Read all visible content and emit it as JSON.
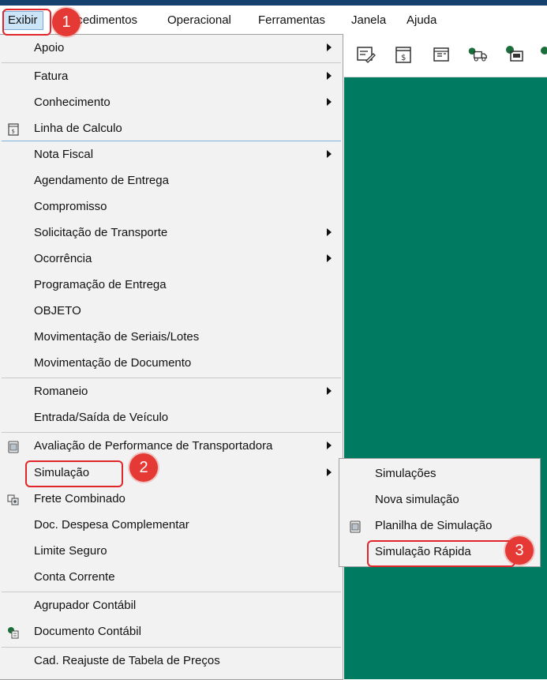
{
  "menubar": {
    "items": [
      {
        "label": "Exibir"
      },
      {
        "label": "Procedimentos"
      },
      {
        "label": "Operacional"
      },
      {
        "label": "Ferramentas"
      },
      {
        "label": "Janela"
      },
      {
        "label": "Ajuda"
      }
    ]
  },
  "exibir_menu": {
    "items": [
      {
        "label": "Apoio"
      },
      {
        "label": "Fatura"
      },
      {
        "label": "Conhecimento"
      },
      {
        "label": "Linha de Calculo"
      },
      {
        "label": "Nota Fiscal"
      },
      {
        "label": "Agendamento de Entrega"
      },
      {
        "label": "Compromisso"
      },
      {
        "label": "Solicitação de Transporte"
      },
      {
        "label": "Ocorrência"
      },
      {
        "label": "Programação de Entrega"
      },
      {
        "label": "OBJETO"
      },
      {
        "label": "Movimentação de Seriais/Lotes"
      },
      {
        "label": "Movimentação de Documento"
      },
      {
        "label": "Romaneio"
      },
      {
        "label": "Entrada/Saída de Veículo"
      },
      {
        "label": "Avaliação de Performance de Transportadora"
      },
      {
        "label": "Simulação"
      },
      {
        "label": "Frete Combinado"
      },
      {
        "label": "Doc. Despesa Complementar"
      },
      {
        "label": "Limite Seguro"
      },
      {
        "label": "Conta Corrente"
      },
      {
        "label": "Agrupador Contábil"
      },
      {
        "label": "Documento Contábil"
      },
      {
        "label": "Cad. Reajuste de Tabela de Preços"
      }
    ]
  },
  "simulacao_submenu": {
    "items": [
      {
        "label": "Simulações"
      },
      {
        "label": "Nova simulação"
      },
      {
        "label": "Planilha de Simulação"
      },
      {
        "label": "Simulação Rápida"
      }
    ]
  },
  "annotations": {
    "step1": "1",
    "step2": "2",
    "step3": "3"
  },
  "colors": {
    "workspace": "#007b62",
    "annotation": "#e53935",
    "titlebar": "#17426f"
  }
}
